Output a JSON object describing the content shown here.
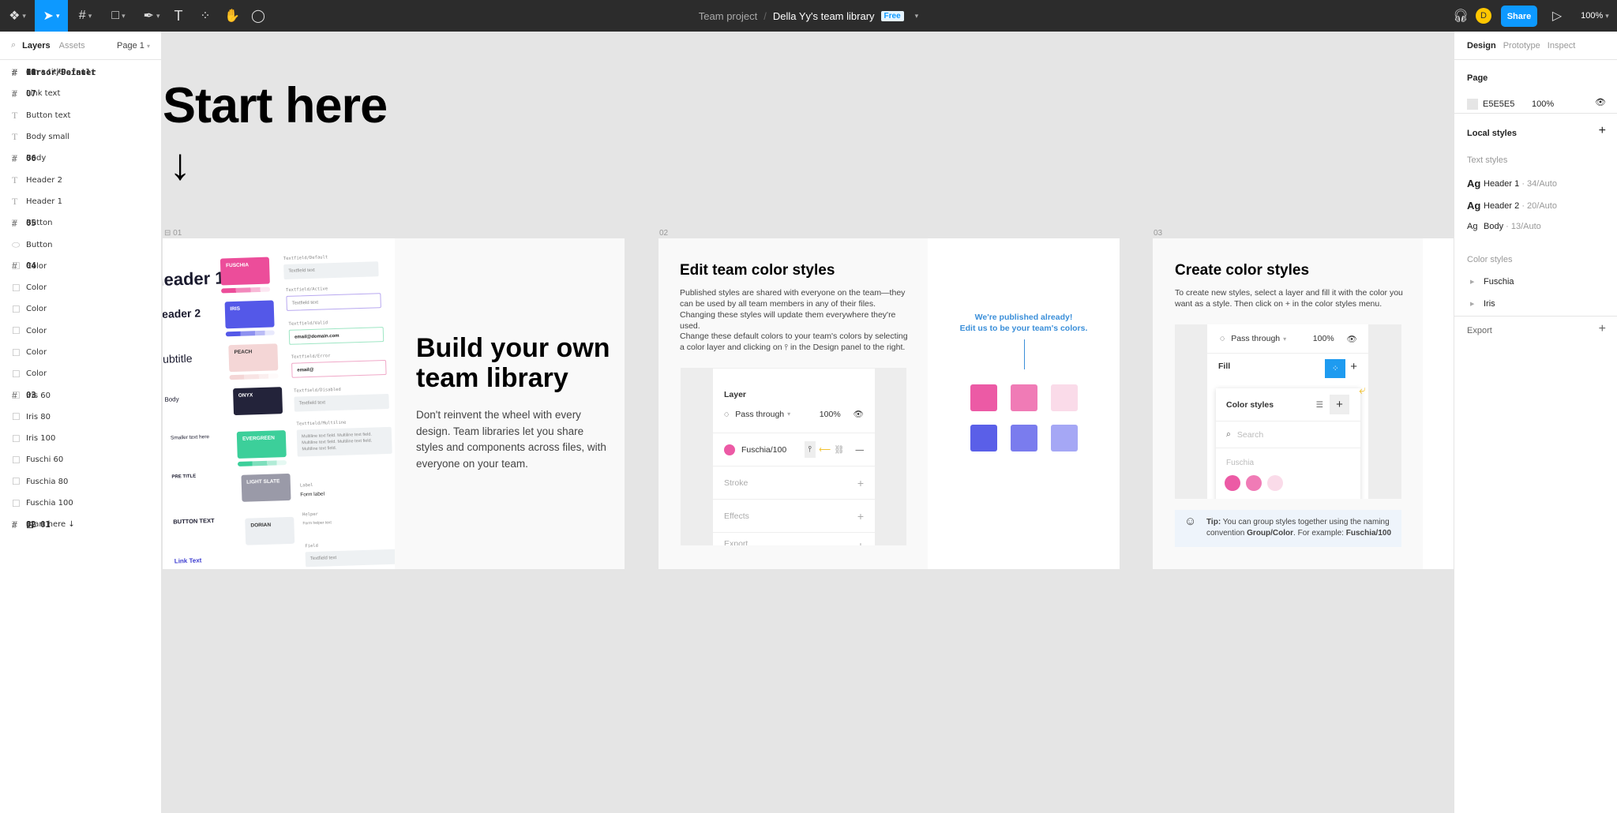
{
  "topbar": {
    "project": "Team project",
    "separator": "/",
    "file": "Della Yy's team library",
    "plan_badge": "Free",
    "avatar_initial": "D",
    "share": "Share",
    "zoom": "100%",
    "tools": [
      "figma-menu",
      "move",
      "frame",
      "shape",
      "pen",
      "text",
      "components",
      "hand",
      "comment"
    ]
  },
  "left_panel": {
    "tabs": [
      "Layers",
      "Assets"
    ],
    "page": "Page 1",
    "layers": [
      {
        "name": "11",
        "type": "frame",
        "locked": true
      },
      {
        "name": "10",
        "type": "frame",
        "locked": true
      },
      {
        "name": "09",
        "type": "frame",
        "locked": true
      },
      {
        "name": "Cursor/Default",
        "type": "frame",
        "locked": false
      },
      {
        "name": "Cursor/Pointer",
        "type": "frame",
        "locked": false
      },
      {
        "name": "08",
        "type": "frame",
        "locked": true
      },
      {
        "name": "I'm a title",
        "type": "text",
        "locked": false
      },
      {
        "name": "07",
        "type": "frame",
        "locked": true
      },
      {
        "name": "Link text",
        "type": "text"
      },
      {
        "name": "Button text",
        "type": "text"
      },
      {
        "name": "Body small",
        "type": "text"
      },
      {
        "name": "06",
        "type": "frame",
        "locked": true
      },
      {
        "name": "Body",
        "type": "text"
      },
      {
        "name": "Header 2",
        "type": "text"
      },
      {
        "name": "Header 1",
        "type": "text"
      },
      {
        "name": "05",
        "type": "frame",
        "locked": true
      },
      {
        "name": "Button",
        "type": "text"
      },
      {
        "name": "Button",
        "type": "ellipse"
      },
      {
        "name": "04",
        "type": "frame",
        "locked": true
      },
      {
        "name": "Color",
        "type": "rect"
      },
      {
        "name": "Color",
        "type": "rect"
      },
      {
        "name": "Color",
        "type": "rect"
      },
      {
        "name": "Color",
        "type": "rect"
      },
      {
        "name": "Color",
        "type": "rect"
      },
      {
        "name": "Color",
        "type": "rect"
      },
      {
        "name": "03",
        "type": "frame",
        "locked": true
      },
      {
        "name": "Iris 60",
        "type": "rect"
      },
      {
        "name": "Iris 80",
        "type": "rect"
      },
      {
        "name": "Iris 100",
        "type": "rect"
      },
      {
        "name": "Fuschi 60",
        "type": "rect"
      },
      {
        "name": "Fuschia 80",
        "type": "rect"
      },
      {
        "name": "Fuschia 100",
        "type": "rect"
      },
      {
        "name": "02",
        "type": "frame",
        "locked": true
      },
      {
        "name": "01",
        "type": "frame-component",
        "locked": true
      },
      {
        "name": "Start here ↓",
        "type": "text"
      }
    ]
  },
  "right_panel": {
    "tabs": [
      "Design",
      "Prototype",
      "Inspect"
    ],
    "page_title": "Page",
    "page_color": "E5E5E5",
    "page_opacity": "100%",
    "local_styles": "Local styles",
    "text_styles_title": "Text styles",
    "text_styles": [
      {
        "sample": "Ag",
        "name": "Header 1",
        "spec": " · 34/Auto"
      },
      {
        "sample": "Ag",
        "name": "Header 2",
        "spec": " · 20/Auto"
      },
      {
        "sample": "Ag",
        "name": "Body",
        "spec": " · 13/Auto"
      }
    ],
    "color_styles_title": "Color styles",
    "color_styles": [
      "Fuschia",
      "Iris"
    ],
    "export": "Export"
  },
  "canvas": {
    "start_title": "Start here",
    "start_arrow": "↓",
    "frame1": {
      "label": "01",
      "heading": "Build your own team library",
      "body": "Don't reinvent the wheel with every design. Team libraries let you share styles and components across files, with everyone on your team.",
      "type_samples": [
        "Header 1",
        "Header 2",
        "Subtitle",
        "Body",
        "Smaller text here",
        "PRE TITLE",
        "BUTTON TEXT",
        "Link Text"
      ],
      "color_cards": [
        {
          "name": "FUSCHIA",
          "color": "#ec4d9a"
        },
        {
          "name": "IRIS",
          "color": "#5458e8"
        },
        {
          "name": "PEACH",
          "color": "#f4d6d6"
        },
        {
          "name": "ONYX",
          "color": "#23233a"
        },
        {
          "name": "EVERGREEN",
          "color": "#3ccf9a"
        },
        {
          "name": "LIGHT SLATE",
          "color": "#9a9aa8"
        },
        {
          "name": "DORIAN",
          "color": "#eceff2"
        }
      ],
      "fields": [
        {
          "label": "Textfield/Default",
          "value": "Textfield text"
        },
        {
          "label": "Textfield/Active",
          "value": "Textfield text"
        },
        {
          "label": "Textfield/Valid",
          "value": "email@domain.com"
        },
        {
          "label": "Textfield/Error",
          "value": "email@"
        },
        {
          "label": "Textfield/Disabled",
          "value": "Textfield text"
        },
        {
          "label": "Textfield/Multiline",
          "value": "Multiline text field. Multiline text field. Multiline text field. Multiline text field. Multiline text field."
        },
        {
          "label": "Label",
          "value": "Form label"
        },
        {
          "label": "Helper",
          "value": "Form helper text"
        },
        {
          "label": "Field",
          "value": "Textfield text"
        }
      ]
    },
    "frame2": {
      "label": "02",
      "heading": "Edit team color styles",
      "para1": "Published styles are shared with everyone on the team—they can be used by all team members in any of their files. Changing these styles will update them everywhere they're used.",
      "para2": "Change these default colors to your team's colors by selecting a color layer and clicking on ⫯ in the Design panel to the right.",
      "mock": {
        "layer": "Layer",
        "blend": "Pass through",
        "opacity": "100%",
        "fill_style": "Fuschia/100",
        "stroke": "Stroke",
        "effects": "Effects",
        "export": "Export"
      },
      "callout1": "We're published already!",
      "callout2": "Edit us to be your team's colors.",
      "swatches": [
        "#ec5aa5",
        "#f07bb6",
        "#fadbe9",
        "#5a5fe8",
        "#7a7cee",
        "#a5a7f5"
      ]
    },
    "frame3": {
      "label": "03",
      "heading": "Create color styles",
      "para": "To create new styles, select a layer and fill it with the color you want as a style. Then click on + in the color styles menu.",
      "mock": {
        "blend": "Pass through",
        "opacity": "100%",
        "fill": "Fill",
        "color_styles": "Color styles",
        "search_placeholder": "Search",
        "group": "Fuschia",
        "dots": [
          "#ec5aa5",
          "#f07bb6",
          "#fadbe9"
        ]
      },
      "tip_label": "Tip:",
      "tip_text": " You can group styles together using the naming convention ",
      "tip_bold1": "Group/Color",
      "tip_text2": ". For example: ",
      "tip_bold2": "Fuschia/100"
    }
  },
  "colors": {
    "accent": "#0d99ff",
    "topbar": "#2c2c2c",
    "canvas": "#e5e5e5",
    "avatar": "#ffc700"
  }
}
